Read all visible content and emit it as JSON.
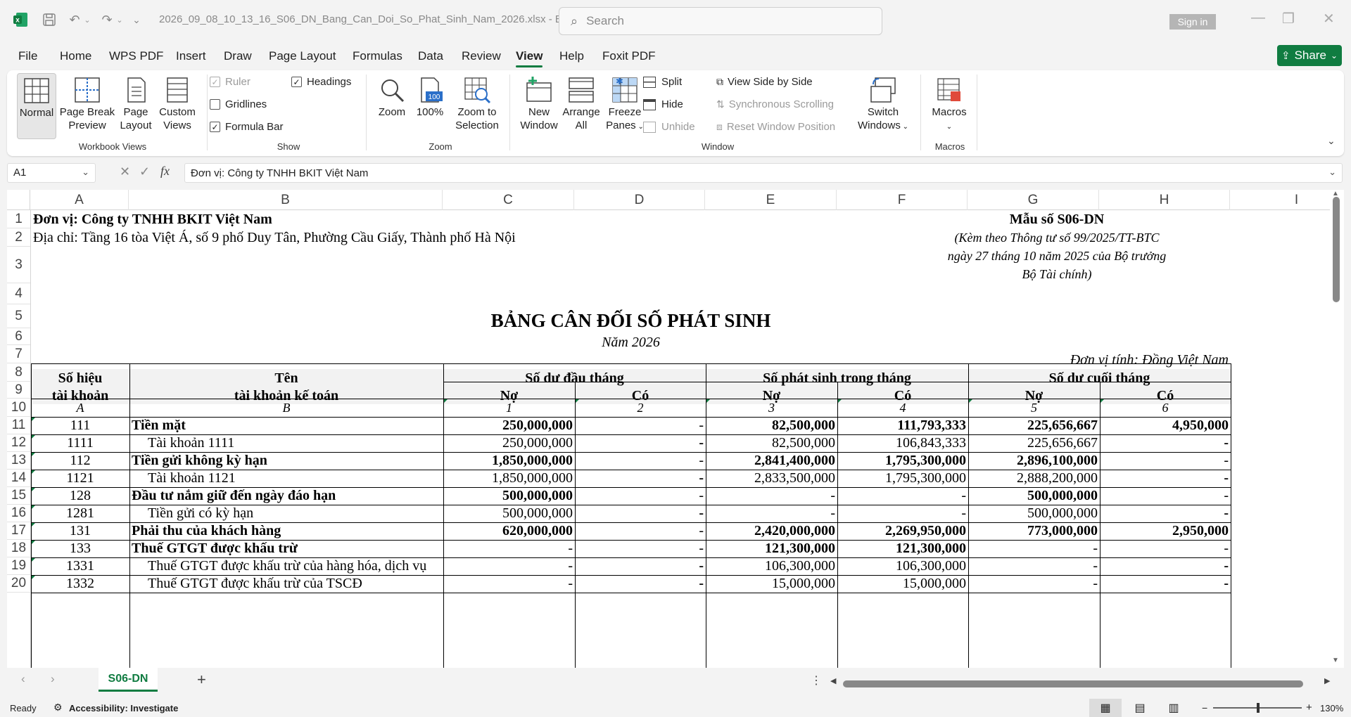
{
  "title_bar": {
    "file_name": "2026_09_08_10_13_16_S06_DN_Bang_Can_Doi_So_Phat_Sinh_Nam_2026.xlsx  -  E...",
    "search_placeholder": "Search",
    "sign_in_label": "Sign in"
  },
  "menu": {
    "items": [
      "File",
      "Home",
      "WPS PDF",
      "Insert",
      "Draw",
      "Page Layout",
      "Formulas",
      "Data",
      "Review",
      "View",
      "Help",
      "Foxit PDF"
    ],
    "active": "View",
    "share_label": "Share"
  },
  "ribbon": {
    "workbook_views": {
      "label": "Workbook Views",
      "normal": "Normal",
      "page_break_1": "Page Break",
      "page_break_2": "Preview",
      "page_layout_1": "Page",
      "page_layout_2": "Layout",
      "custom_1": "Custom",
      "custom_2": "Views"
    },
    "show": {
      "label": "Show",
      "ruler": "Ruler",
      "gridlines": "Gridlines",
      "formula_bar": "Formula Bar",
      "headings": "Headings"
    },
    "zoom": {
      "label": "Zoom",
      "zoom": "Zoom",
      "hundred": "100%",
      "hundred_icon_text": "100",
      "sel_1": "Zoom to",
      "sel_2": "Selection"
    },
    "window": {
      "label": "Window",
      "new_1": "New",
      "new_2": "Window",
      "arrange_1": "Arrange",
      "arrange_2": "All",
      "freeze_1": "Freeze",
      "freeze_2": "Panes",
      "split": "Split",
      "hide": "Hide",
      "unhide": "Unhide",
      "side_by_side": "View Side by Side",
      "sync_scroll": "Synchronous Scrolling",
      "reset_pos": "Reset Window Position",
      "switch_1": "Switch",
      "switch_2": "Windows"
    },
    "macros": {
      "label": "Macros",
      "macros": "Macros"
    }
  },
  "formula_bar": {
    "name_box": "A1",
    "fx_label": "fx",
    "content": "Đơn vị: Công ty TNHH BKIT Việt Nam"
  },
  "columns": [
    "A",
    "B",
    "C",
    "D",
    "E",
    "F",
    "G",
    "H",
    "I"
  ],
  "rows": [
    "1",
    "2",
    "3",
    "4",
    "5",
    "6",
    "7",
    "8",
    "9",
    "10",
    "11",
    "12",
    "13",
    "14",
    "15",
    "16",
    "17",
    "18",
    "19",
    "20"
  ],
  "header_info": {
    "company": "Đơn vị: Công ty TNHH BKIT Việt Nam",
    "address": "Địa chỉ: Tầng 16 tòa Việt Á, số 9 phố Duy Tân, Phường Cầu Giấy, Thành phố Hà Nội",
    "form_no": "Mẫu số S06-DN",
    "circular_1": "(Kèm theo Thông tư số 99/2025/TT-BTC",
    "circular_2": "ngày 27 tháng 10 năm 2025 của Bộ trưởng",
    "circular_3": "Bộ Tài chính)",
    "report_title": "BẢNG CÂN ĐỐI SỐ PHÁT SINH",
    "year": "Năm 2026",
    "unit": "Đơn vị tính: Đồng Việt Nam"
  },
  "table_header": {
    "acct_no_1": "Số hiệu",
    "acct_no_2": "tài khoản",
    "acct_name_1": "Tên",
    "acct_name_2": "tài khoản kế toán",
    "opening": "Số dư đầu tháng",
    "movement": "Số phát sinh trong tháng",
    "closing": "Số dư cuối tháng",
    "debit": "Nợ",
    "credit": "Có",
    "codes": [
      "A",
      "B",
      "1",
      "2",
      "3",
      "4",
      "5",
      "6"
    ]
  },
  "table_rows": [
    {
      "code": "111",
      "name": "Tiền mặt",
      "bold": true,
      "v": [
        "250,000,000",
        "-",
        "82,500,000",
        "111,793,333",
        "225,656,667",
        "4,950,000"
      ]
    },
    {
      "code": "1111",
      "name": "Tài khoản 1111",
      "bold": false,
      "v": [
        "250,000,000",
        "-",
        "82,500,000",
        "106,843,333",
        "225,656,667",
        "-"
      ]
    },
    {
      "code": "112",
      "name": "Tiền gửi không kỳ hạn",
      "bold": true,
      "v": [
        "1,850,000,000",
        "-",
        "2,841,400,000",
        "1,795,300,000",
        "2,896,100,000",
        "-"
      ]
    },
    {
      "code": "1121",
      "name": "Tài khoản 1121",
      "bold": false,
      "v": [
        "1,850,000,000",
        "-",
        "2,833,500,000",
        "1,795,300,000",
        "2,888,200,000",
        "-"
      ]
    },
    {
      "code": "128",
      "name": "Đầu tư nắm giữ đến ngày đáo hạn",
      "bold": true,
      "v": [
        "500,000,000",
        "-",
        "-",
        "-",
        "500,000,000",
        "-"
      ]
    },
    {
      "code": "1281",
      "name": "Tiền gửi có kỳ hạn",
      "bold": false,
      "v": [
        "500,000,000",
        "-",
        "-",
        "-",
        "500,000,000",
        "-"
      ]
    },
    {
      "code": "131",
      "name": "Phải thu của khách hàng",
      "bold": true,
      "v": [
        "620,000,000",
        "-",
        "2,420,000,000",
        "2,269,950,000",
        "773,000,000",
        "2,950,000"
      ]
    },
    {
      "code": "133",
      "name": "Thuế GTGT được khấu trừ",
      "bold": true,
      "v": [
        "-",
        "-",
        "121,300,000",
        "121,300,000",
        "-",
        "-"
      ]
    },
    {
      "code": "1331",
      "name": "Thuế GTGT được khấu trừ của hàng hóa, dịch vụ",
      "bold": false,
      "v": [
        "-",
        "-",
        "106,300,000",
        "106,300,000",
        "-",
        "-"
      ]
    },
    {
      "code": "1332",
      "name": "Thuế GTGT được khấu trừ của TSCĐ",
      "bold": false,
      "v": [
        "-",
        "-",
        "15,000,000",
        "15,000,000",
        "-",
        "-"
      ]
    }
  ],
  "sheet_tab": "S06-DN",
  "status": {
    "ready": "Ready",
    "accessibility": "Accessibility: Investigate",
    "zoom_level": "130%"
  }
}
